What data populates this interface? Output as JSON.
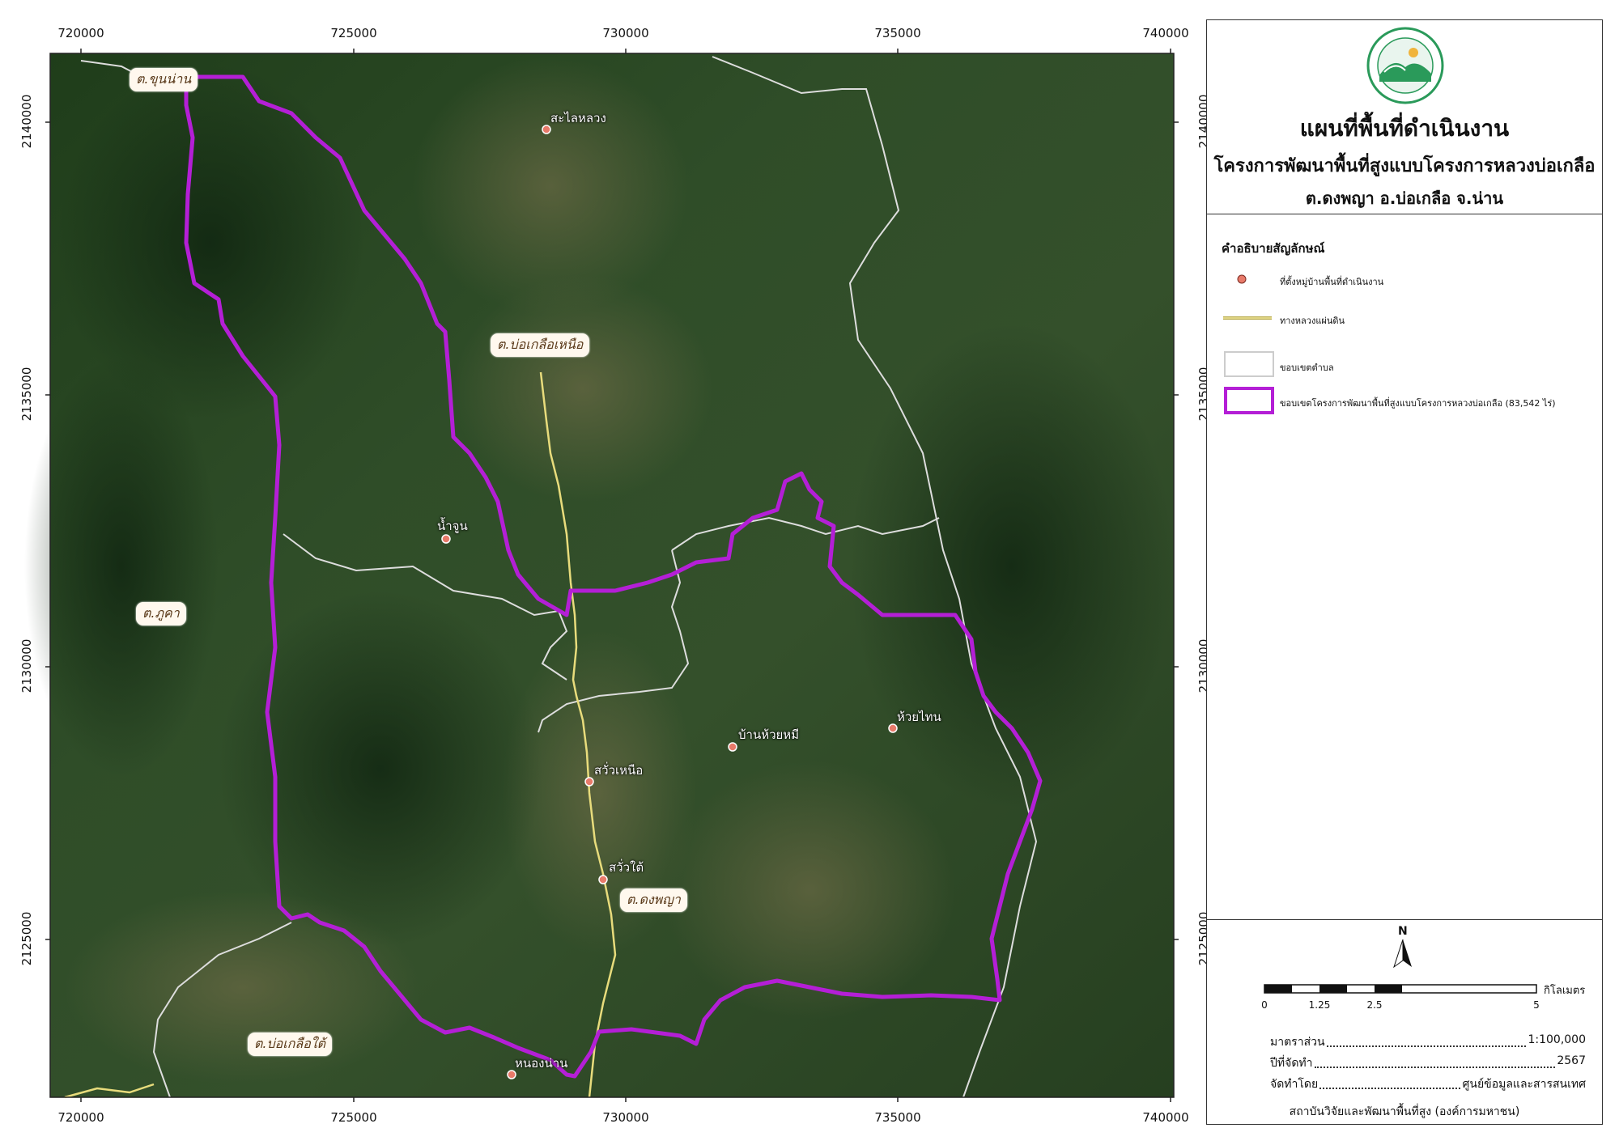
{
  "colors": {
    "project_boundary": "#b41fd6",
    "subdistrict_boundary": "#dddddd",
    "road": "#e8dc7c",
    "village_marker": "#e87a6a"
  },
  "axes": {
    "x_ticks": [
      "720000",
      "725000",
      "730000",
      "735000",
      "740000"
    ],
    "y_ticks": [
      "2140000",
      "2135000",
      "2130000",
      "2125000"
    ]
  },
  "villages": [
    {
      "name": "สะไลหลวง"
    },
    {
      "name": "น้ำจูน"
    },
    {
      "name": "สวั่วเหนือ"
    },
    {
      "name": "สวั่วใต้"
    },
    {
      "name": "บ้านห้วยหมี"
    },
    {
      "name": "ห้วยไทน"
    },
    {
      "name": "หนองน่าน"
    }
  ],
  "subdistricts": [
    {
      "name": "ต.ขุนน่าน"
    },
    {
      "name": "ต.บ่อเกลือเหนือ"
    },
    {
      "name": "ต.ภูคา"
    },
    {
      "name": "ต.ดงพญา"
    },
    {
      "name": "ต.บ่อเกลือใต้"
    }
  ],
  "title": {
    "logo": "hrdi-seal",
    "main": "แผนที่พื้นที่ดำเนินงาน",
    "project": "โครงการพัฒนาพื้นที่สูงแบบโครงการหลวงบ่อเกลือ",
    "area": "ต.ดงพญา อ.บ่อเกลือ จ.น่าน"
  },
  "legend": {
    "heading": "คำอธิบายสัญลักษณ์",
    "items": [
      {
        "symbol": "village-marker-icon",
        "label": "ที่ตั้งหมู่บ้านพื้นที่ดำเนินงาน"
      },
      {
        "symbol": "road-line",
        "label": "ทางหลวงแผ่นดิน"
      },
      {
        "symbol": "subdistrict-boundary-box",
        "label": "ขอบเขตตำบล"
      },
      {
        "symbol": "project-boundary-box",
        "label": "ขอบเขตโครงการพัฒนาพื้นที่สูงแบบโครงการหลวงบ่อเกลือ (83,542 ไร่)"
      }
    ]
  },
  "north_arrow": "N",
  "scale_bar": {
    "unit": "กิโลเมตร",
    "labels": [
      "0",
      "1.25",
      "2.5",
      "5"
    ]
  },
  "info": {
    "scale_key": "มาตราส่วน",
    "scale_value": "1:100,000",
    "year_key": "ปีที่จัดทำ",
    "year_value": "2567",
    "by_key": "จัดทำโดย",
    "by_value": "ศูนย์ข้อมูลและสารสนเทศ"
  },
  "footer": "สถาบันวิจัยและพัฒนาพื้นที่สูง (องค์การมหาชน)"
}
